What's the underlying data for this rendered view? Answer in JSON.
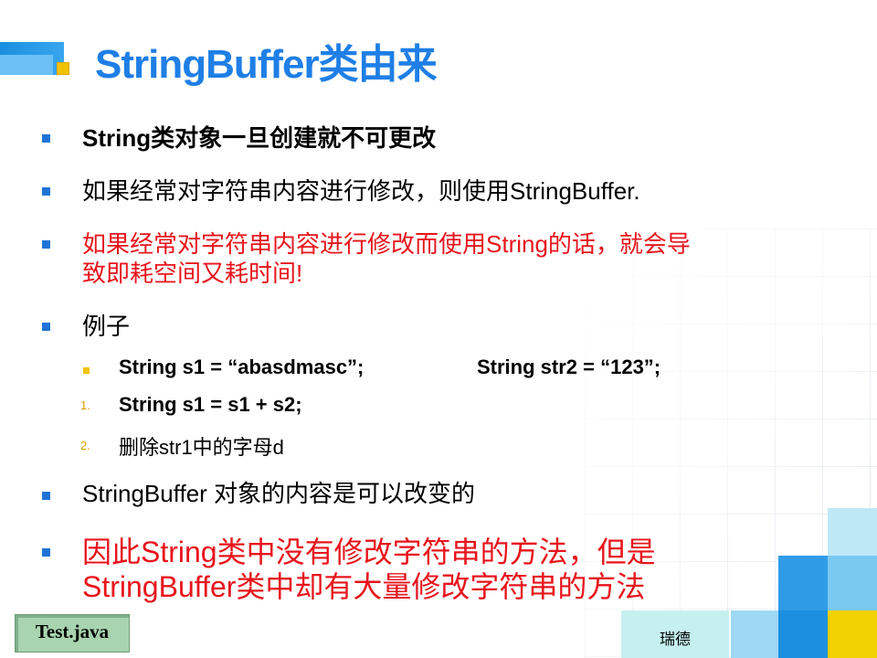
{
  "title": "StringBuffer类由来",
  "bullets": [
    {
      "text": "String类对象一旦创建就不可更改"
    },
    {
      "text": "如果经常对字符串内容进行修改，则使用StringBuffer."
    },
    {
      "line1": "如果经常对字符串内容进行修改而使用String的话，就会导",
      "line2": "致即耗空间又耗时间!"
    },
    {
      "text": "例子"
    },
    {
      "text": "StringBuffer 对象的内容是可以改变的"
    },
    {
      "line1": "因此String类中没有修改字符串的方法，但是",
      "line2": "StringBuffer类中却有大量修改字符串的方法"
    }
  ],
  "sub_items": [
    {
      "marker": "",
      "text": "String s1 = “abasdmasc”;",
      "text2": "String str2 = “123”;"
    },
    {
      "marker": "1.",
      "text": "String s1 = s1 + s2;"
    },
    {
      "marker": "2.",
      "text": "删除str1中的字母d"
    }
  ],
  "footer": {
    "left_label": "Test.java",
    "right_label": "瑞德"
  },
  "colors": {
    "title": "#1f7fe6",
    "bullet": "#1f73d6",
    "sub_bullet": "#f2c200",
    "emphasis": "#e8141c"
  }
}
